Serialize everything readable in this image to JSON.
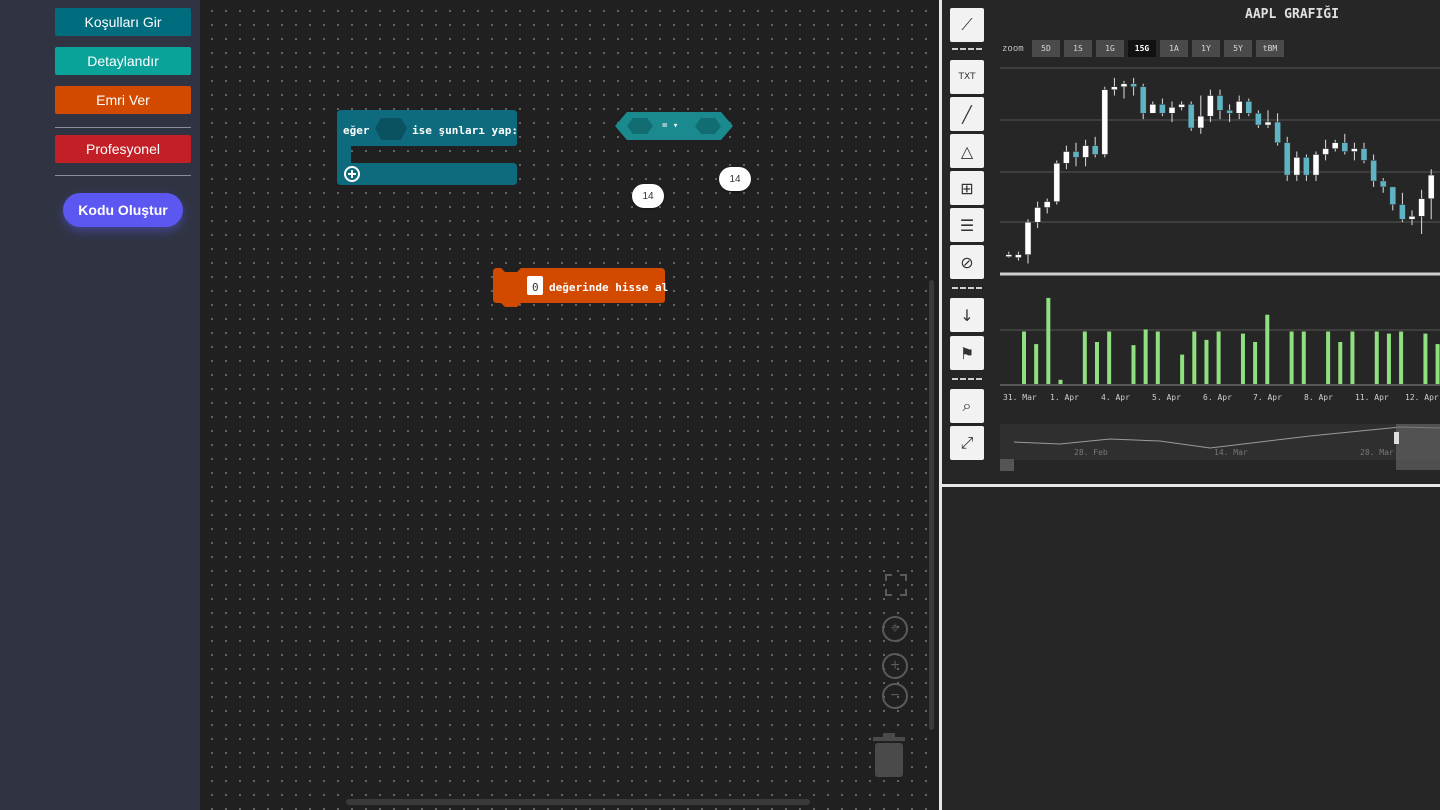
{
  "sidebar": {
    "buttons": [
      {
        "label": "Koşulları Gir",
        "color": "#006d7e"
      },
      {
        "label": "Detaylandır",
        "color": "#0aa39a"
      },
      {
        "label": "Emri Ver",
        "color": "#d14a00"
      },
      {
        "label": "Profesyonel",
        "color": "#c21f26"
      }
    ],
    "generate_label": "Kodu Oluştur"
  },
  "workspace": {
    "if_block": {
      "prefix": "eğer",
      "suffix": "ise şunları yap:",
      "color": "#0e6a7d"
    },
    "compare_block": {
      "operator": "= ▾",
      "color": "#1a8a8f"
    },
    "numbers": [
      "14",
      "14"
    ],
    "buy_block": {
      "value": "0",
      "label": "değerinde hisse al",
      "color": "#d14a00"
    }
  },
  "chart": {
    "title": "AAPL GRAFIĞI",
    "zoom_label": "zoom",
    "zoom_options": [
      "5D",
      "1S",
      "1G",
      "15G",
      "1A",
      "1Y",
      "5Y",
      "tBM"
    ],
    "zoom_active": "15G",
    "x_labels": [
      "31. Mar",
      "1. Apr",
      "4. Apr",
      "5. Apr",
      "6. Apr",
      "7. Apr",
      "8. Apr",
      "11. Apr",
      "12. Apr"
    ],
    "nav_labels": [
      "28. Feb",
      "14. Mar",
      "28. Mar"
    ],
    "tools": [
      "trend-lines-icon",
      "text-icon",
      "line-icon",
      "pattern-abc-icon",
      "crosshair-grid-icon",
      "fibonacci-icon",
      "hide-icon",
      "counter-icon",
      "flag-icon",
      "zoom-icon",
      "fullscreen-icon"
    ]
  },
  "chart_data": {
    "type": "candlestick",
    "title": "AAPL GRAFIĞI",
    "xlabel": "",
    "ylabel": "",
    "categories": [
      "31. Mar",
      "1. Apr",
      "4. Apr",
      "5. Apr",
      "6. Apr",
      "7. Apr",
      "8. Apr",
      "11. Apr",
      "12. Apr"
    ],
    "ohlc": [
      [
        83,
        84,
        82,
        83
      ],
      [
        82,
        84,
        81,
        83
      ],
      [
        83,
        95,
        80,
        94
      ],
      [
        94,
        101,
        92,
        99
      ],
      [
        99,
        102,
        97,
        101
      ],
      [
        101,
        115,
        100,
        114
      ],
      [
        114,
        120,
        112,
        118
      ],
      [
        118,
        121,
        113,
        116
      ],
      [
        116,
        122,
        113,
        120
      ],
      [
        120,
        123,
        116,
        117
      ],
      [
        117,
        140,
        116,
        139
      ],
      [
        139,
        143,
        137,
        140
      ],
      [
        140,
        142,
        136,
        141
      ],
      [
        141,
        143,
        137,
        140
      ],
      [
        140,
        141,
        129,
        131
      ],
      [
        131,
        135,
        131,
        134
      ],
      [
        134,
        136,
        130,
        131
      ],
      [
        131,
        135,
        128,
        133
      ],
      [
        133,
        135,
        132,
        134
      ],
      [
        134,
        135,
        125,
        126
      ],
      [
        126,
        137,
        124,
        130
      ],
      [
        130,
        139,
        128,
        137
      ],
      [
        137,
        139,
        129,
        132
      ],
      [
        132,
        134,
        128,
        131
      ],
      [
        131,
        137,
        129,
        135
      ],
      [
        135,
        136,
        130,
        131
      ],
      [
        131,
        132,
        126,
        127
      ],
      [
        127,
        132,
        126,
        128
      ],
      [
        128,
        131,
        120,
        121
      ],
      [
        121,
        123,
        108,
        110
      ],
      [
        110,
        118,
        108,
        116
      ],
      [
        116,
        117,
        108,
        110
      ],
      [
        110,
        118,
        108,
        117
      ],
      [
        117,
        122,
        115,
        119
      ],
      [
        119,
        122,
        118,
        121
      ],
      [
        121,
        124,
        117,
        118
      ],
      [
        118,
        121,
        115,
        119
      ],
      [
        119,
        121,
        114,
        115
      ],
      [
        115,
        117,
        106,
        108
      ],
      [
        108,
        109,
        104,
        106
      ],
      [
        106,
        106,
        98,
        100
      ],
      [
        100,
        104,
        94,
        95
      ],
      [
        95,
        98,
        93,
        96
      ],
      [
        96,
        105,
        90,
        102
      ],
      [
        102,
        112,
        95,
        110
      ]
    ],
    "volume": [
      [
        50,
        38,
        82,
        4,
        0,
        50,
        40,
        50,
        0,
        37,
        52,
        50,
        0,
        28,
        50,
        42,
        50,
        0,
        48,
        40,
        66,
        0,
        50,
        50,
        0,
        50,
        40,
        50,
        0,
        50,
        48,
        50,
        0,
        48,
        38,
        50,
        0,
        60
      ]
    ],
    "ylim": [
      90,
      145
    ]
  }
}
